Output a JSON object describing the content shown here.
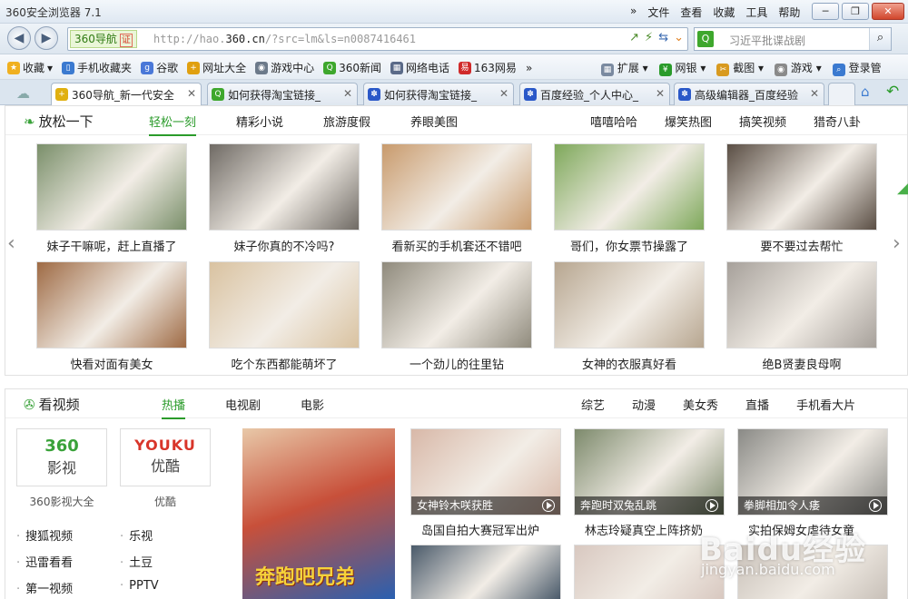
{
  "window": {
    "title": "360安全浏览器 7.1",
    "menu": [
      "»",
      "文件",
      "查看",
      "收藏",
      "工具",
      "帮助"
    ]
  },
  "address": {
    "site_badge": "360导航",
    "cert_badge": "证",
    "url_prefix": "http://hao.",
    "url_domain": "360.cn",
    "url_rest": "/?src=lm&ls=n0087416461",
    "search_value": "习近平批谍战剧"
  },
  "favbar": {
    "items": [
      "收藏",
      "手机收藏夹",
      "谷歌",
      "网址大全",
      "游戏中心",
      "360新闻",
      "网络电话",
      "163网易",
      "»"
    ],
    "right_items": [
      "扩展",
      "网银",
      "截图",
      "游戏",
      "登录管"
    ]
  },
  "tabs": [
    {
      "label": "360导航_新一代安全"
    },
    {
      "label": "如何获得淘宝链接_"
    },
    {
      "label": "如何获得淘宝链接_"
    },
    {
      "label": "百度经验_个人中心_"
    },
    {
      "label": "高级编辑器_百度经验"
    }
  ],
  "relax": {
    "title": "放松一下",
    "tabs": [
      "轻松一刻",
      "精彩小说",
      "旅游度假",
      "养眼美图"
    ],
    "right_tabs": [
      "嘻嘻哈哈",
      "爆笑热图",
      "搞笑视频",
      "猎奇八卦"
    ],
    "items": [
      {
        "caption": "妹子干嘛呢，赶上直播了",
        "color": "#7a8f6a"
      },
      {
        "caption": "妹子你真的不冷吗?",
        "color": "#6f6a64"
      },
      {
        "caption": "看新买的手机套还不错吧",
        "color": "#c89a6c"
      },
      {
        "caption": "哥们，你女票节操露了",
        "color": "#7ea85a"
      },
      {
        "caption": "要不要过去帮忙",
        "color": "#5a4e44"
      },
      {
        "caption": "快看对面有美女",
        "color": "#9e6a44"
      },
      {
        "caption": "吃个东西都能萌坏了",
        "color": "#d9c2a0"
      },
      {
        "caption": "一个劲儿的往里钻",
        "color": "#8f8a7c"
      },
      {
        "caption": "女神的衣服真好看",
        "color": "#b7a690"
      },
      {
        "caption": "绝B贤妻良母啊",
        "color": "#a6a09a"
      }
    ]
  },
  "video": {
    "title": "看视频",
    "tabs": [
      "热播",
      "电视剧",
      "电影"
    ],
    "right_tabs": [
      "综艺",
      "动漫",
      "美女秀",
      "直播",
      "手机看大片"
    ],
    "logos": [
      {
        "name": "360影视大全",
        "line1": "360",
        "line2": "影视"
      },
      {
        "name": "优酷",
        "line1": "YOUKU",
        "line2": "优酷"
      }
    ],
    "links": [
      "搜狐视频",
      "乐视",
      "迅雷看看",
      "土豆",
      "第一视频",
      "PPTV"
    ],
    "items": [
      {
        "overlay": "女神铃木咲获胜",
        "caption": "岛国自拍大赛冠军出炉",
        "color": "#d8b8a8"
      },
      {
        "overlay": "奔跑时双兔乱跳",
        "caption": "林志玲疑真空上阵挤奶",
        "color": "#7d8a6c"
      },
      {
        "overlay": "拳脚相加令人痿",
        "caption": "实拍保姆女虐待女童",
        "color": "#8a8a86"
      }
    ],
    "bottom_colors": [
      "#4a5a6a",
      "#d8c8c0",
      "#c8c0b8"
    ],
    "feature_text": "奔跑吧兄弟"
  },
  "watermark": {
    "brand": "Baidu经验",
    "url": "jingyan.baidu.com"
  }
}
